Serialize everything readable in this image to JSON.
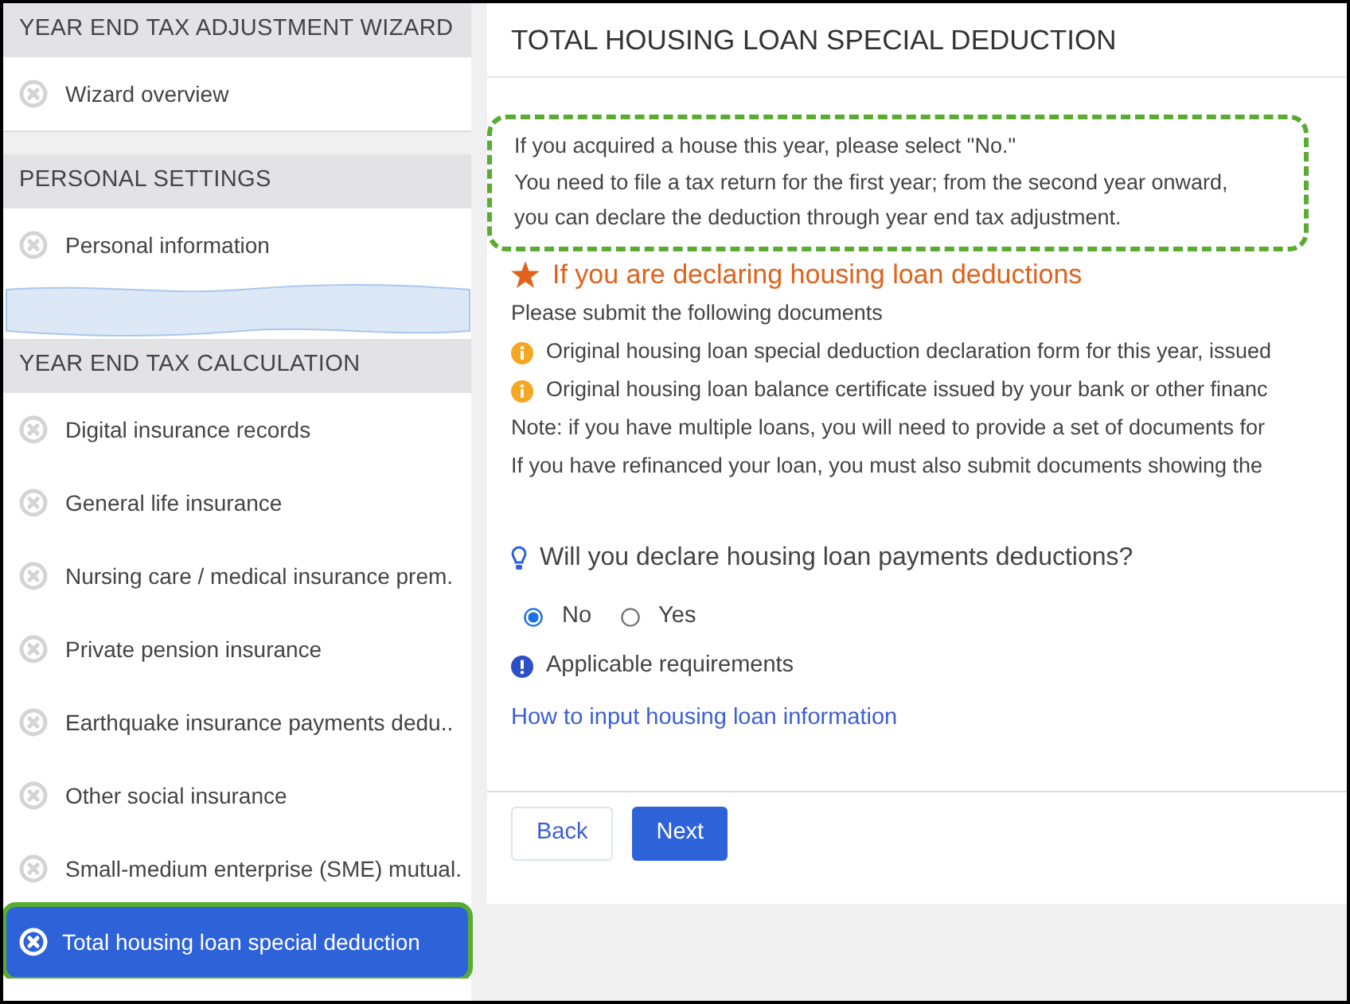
{
  "sidebar": {
    "sections": [
      {
        "title": "YEAR END TAX ADJUSTMENT WIZARD",
        "items": [
          {
            "label": "Wizard overview",
            "selected": false
          }
        ]
      },
      {
        "title": "PERSONAL SETTINGS",
        "items": [
          {
            "label": "Personal information",
            "selected": false
          }
        ],
        "torn_after": true
      },
      {
        "title": "YEAR END TAX CALCULATION",
        "items": [
          {
            "label": "Digital insurance records",
            "selected": false
          },
          {
            "label": "General life insurance",
            "selected": false
          },
          {
            "label": "Nursing care / medical insurance prem.",
            "selected": false
          },
          {
            "label": "Private pension insurance",
            "selected": false
          },
          {
            "label": "Earthquake insurance payments dedu..",
            "selected": false
          },
          {
            "label": "Other social insurance",
            "selected": false
          },
          {
            "label": "Small-medium enterprise (SME) mutual.",
            "selected": false
          },
          {
            "label": "Total housing loan special deduction",
            "selected": true
          }
        ]
      }
    ]
  },
  "main": {
    "title": "TOTAL HOUSING LOAN SPECIAL DEDUCTION",
    "notice": [
      "If you acquired a house this year, please select \"No.\"",
      "You need to file a tax return for the first year; from the second year onward,",
      "you can declare the deduction through year end tax adjustment."
    ],
    "heading": "If you are declaring housing loan deductions",
    "lines": [
      {
        "kind": "plain",
        "text": "Please submit the following documents"
      },
      {
        "kind": "info",
        "text": "Original housing loan special deduction declaration form for this year, issued"
      },
      {
        "kind": "info",
        "text": "Original housing loan balance certificate issued by your bank or other financ"
      },
      {
        "kind": "plain",
        "text": "Note: if you have multiple loans, you will need to provide a set of documents for"
      },
      {
        "kind": "plain",
        "text": "If you have refinanced your loan, you must also submit documents showing the"
      }
    ],
    "question": "Will you declare housing loan payments deductions?",
    "options": [
      {
        "label": "No",
        "selected": true
      },
      {
        "label": "Yes",
        "selected": false
      }
    ],
    "requirements": "Applicable requirements",
    "link": "How to input housing loan information",
    "buttons": [
      {
        "label": "Back",
        "kind": "secondary"
      },
      {
        "label": "Next",
        "kind": "primary"
      }
    ]
  }
}
